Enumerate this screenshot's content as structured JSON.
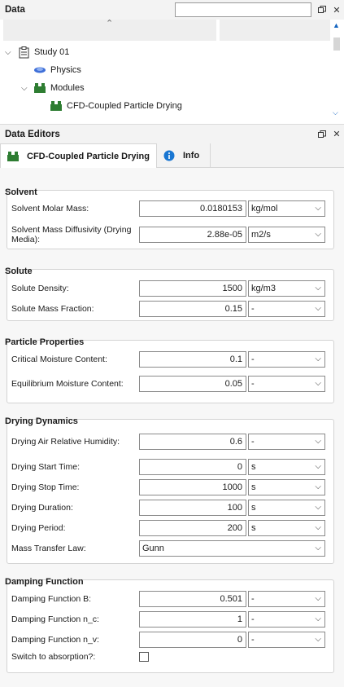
{
  "data_panel": {
    "title": "Data",
    "search_value": "",
    "tree": [
      {
        "label": "Study 01",
        "expanded": true,
        "icon": "clipboard-icon"
      },
      {
        "label": "Physics",
        "icon": "physics-icon"
      },
      {
        "label": "Modules",
        "expanded": true,
        "icon": "modules-icon"
      },
      {
        "label": "CFD-Coupled Particle Drying",
        "icon": "module-icon"
      }
    ]
  },
  "editors_panel": {
    "title": "Data Editors",
    "tabs": [
      {
        "label": "CFD-Coupled Particle Drying",
        "active": true
      },
      {
        "label": "Info",
        "active": false
      }
    ]
  },
  "groups": {
    "solvent": {
      "title": "Solvent",
      "fields": [
        {
          "label": "Solvent Molar Mass:",
          "value": "0.0180153",
          "unit": "kg/mol"
        },
        {
          "label": "Solvent Mass Diffusivity (Drying Media):",
          "value": "2.88e-05",
          "unit": "m2/s"
        }
      ]
    },
    "solute": {
      "title": "Solute",
      "fields": [
        {
          "label": "Solute Density:",
          "value": "1500",
          "unit": "kg/m3"
        },
        {
          "label": "Solute Mass Fraction:",
          "value": "0.15",
          "unit": "-"
        }
      ]
    },
    "particle": {
      "title": "Particle Properties",
      "fields": [
        {
          "label": "Critical Moisture Content:",
          "value": "0.1",
          "unit": "-"
        },
        {
          "label": "Equilibrium Moisture Content:",
          "value": "0.05",
          "unit": "-"
        }
      ]
    },
    "drying": {
      "title": "Drying Dynamics",
      "fields": [
        {
          "label": "Drying Air Relative Humidity:",
          "value": "0.6",
          "unit": "-"
        },
        {
          "label": "Drying Start Time:",
          "value": "0",
          "unit": "s"
        },
        {
          "label": "Drying Stop Time:",
          "value": "1000",
          "unit": "s"
        },
        {
          "label": "Drying Duration:",
          "value": "100",
          "unit": "s"
        },
        {
          "label": "Drying Period:",
          "value": "200",
          "unit": "s"
        }
      ],
      "mass_transfer": {
        "label": "Mass Transfer Law:",
        "value": "Gunn"
      }
    },
    "damping": {
      "title": "Damping Function",
      "fields": [
        {
          "label": "Damping Function B:",
          "value": "0.501",
          "unit": "-"
        },
        {
          "label": "Damping Function n_c:",
          "value": "1",
          "unit": "-"
        },
        {
          "label": "Damping Function n_v:",
          "value": "0",
          "unit": "-"
        }
      ],
      "switch": {
        "label": "Switch to absorption?:",
        "checked": false
      }
    }
  },
  "colors": {
    "module_green": "#2e7d32",
    "info_blue": "#1976d2",
    "physics_blue": "#3f6fd8"
  }
}
